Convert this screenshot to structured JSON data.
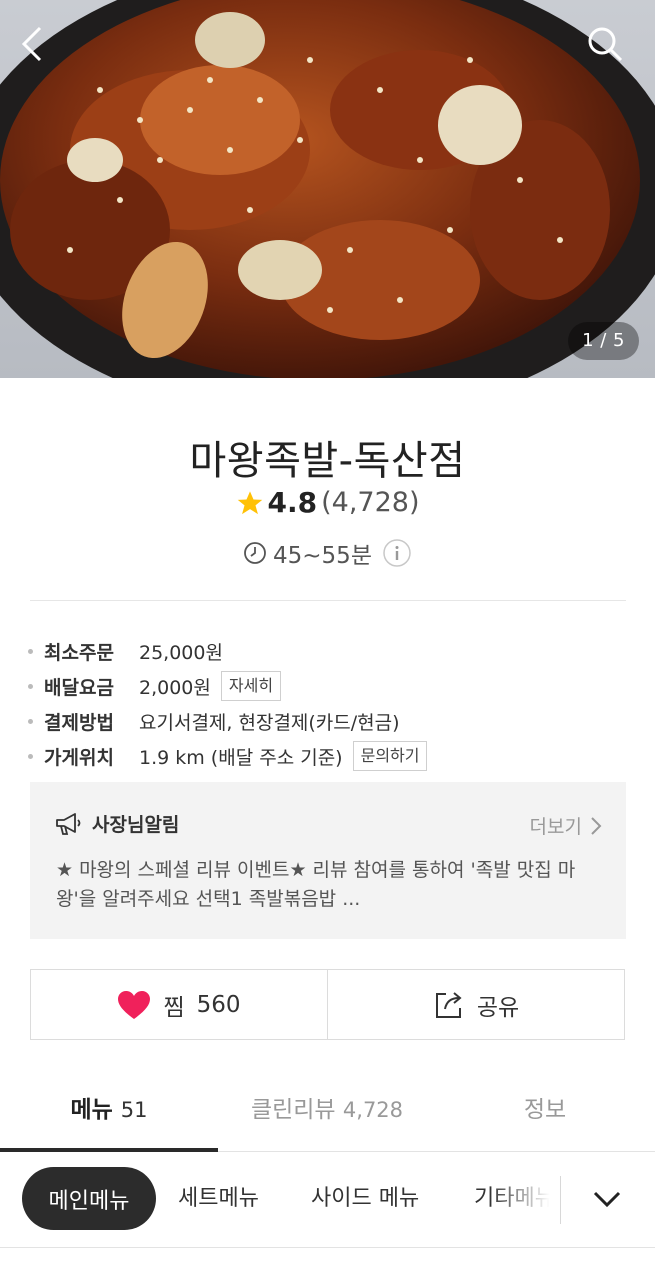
{
  "hero": {
    "image_label": "족발볶음 음식 사진",
    "counter": "1 / 5"
  },
  "store": {
    "name": "마왕족발-독산점",
    "rating": "4.8",
    "review_count": "(4,728)",
    "delivery_time": "45~55분"
  },
  "info": [
    {
      "label": "최소주문",
      "value": "25,000원"
    },
    {
      "label": "배달요금",
      "value": "2,000원",
      "button": "자세히"
    },
    {
      "label": "결제방법",
      "value": "요기서결제, 현장결제(카드/현금)"
    },
    {
      "label": "가게위치",
      "value": "1.9 km (배달 주소 기준)",
      "button": "문의하기"
    }
  ],
  "notice": {
    "title": "사장님알림",
    "more": "더보기",
    "body": "★ 마왕의 스페셜 리뷰 이벤트★  리뷰 참여를 통하여 '족발 맛집 마왕'을 알려주세요   선택1 족발볶음밥 ..."
  },
  "actions": {
    "like_label": "찜",
    "like_count": "560",
    "share_label": "공유"
  },
  "tabs": [
    {
      "label": "메뉴",
      "count": "51"
    },
    {
      "label": "클린리뷰",
      "count": "4,728"
    },
    {
      "label": "정보",
      "count": ""
    }
  ],
  "categories": [
    "메인메뉴",
    "세트메뉴",
    "사이드 메뉴",
    "기타메뉴"
  ],
  "colors": {
    "heart": "#f0215b",
    "star": "#ffc107",
    "active_chip": "#2c2c2c"
  }
}
